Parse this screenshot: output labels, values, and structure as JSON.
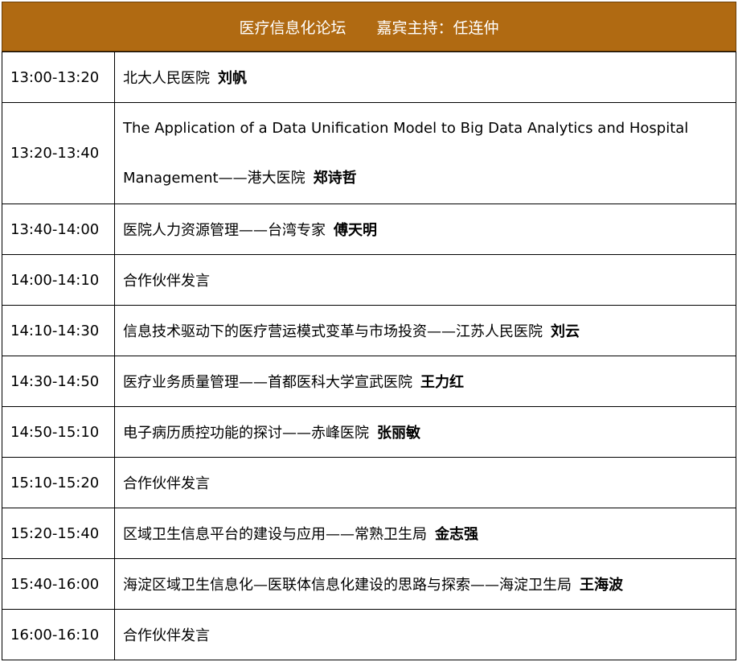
{
  "header": {
    "forum": "医疗信息化论坛",
    "host": "嘉宾主持：任连仲"
  },
  "sessions": [
    {
      "time": "13:00-13:20",
      "topic": "北大人民医院",
      "speaker": "刘帆"
    },
    {
      "time": "13:20-13:40",
      "topic": "The Application of a Data Unification Model to Big Data Analytics and Hospital Management——港大医院",
      "speaker": "郑诗哲"
    },
    {
      "time": "13:40-14:00",
      "topic": "医院人力资源管理——台湾专家",
      "speaker": "傅天明"
    },
    {
      "time": "14:00-14:10",
      "topic": "合作伙伴发言",
      "speaker": ""
    },
    {
      "time": "14:10-14:30",
      "topic": "信息技术驱动下的医疗营运模式变革与市场投资——江苏人民医院",
      "speaker": "刘云"
    },
    {
      "time": "14:30-14:50",
      "topic": "医疗业务质量管理——首都医科大学宣武医院",
      "speaker": "王力红"
    },
    {
      "time": "14:50-15:10",
      "topic": "电子病历质控功能的探讨——赤峰医院",
      "speaker": "张丽敏"
    },
    {
      "time": "15:10-15:20",
      "topic": "合作伙伴发言",
      "speaker": ""
    },
    {
      "time": "15:20-15:40",
      "topic": "区域卫生信息平台的建设与应用——常熟卫生局",
      "speaker": "金志强"
    },
    {
      "time": "15:40-16:00",
      "topic": "海淀区域卫生信息化—医联体信息化建设的思路与探索——海淀卫生局",
      "speaker": "王海波"
    },
    {
      "time": "16:00-16:10",
      "topic": "合作伙伴发言",
      "speaker": ""
    }
  ]
}
